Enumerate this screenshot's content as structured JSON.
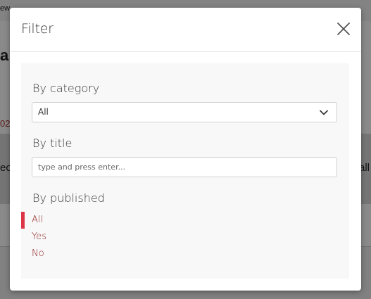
{
  "background": {
    "frag_top": "ew",
    "frag_header": "a",
    "frag_red": "02",
    "frag_left": "ect",
    "frag_right": "all"
  },
  "modal": {
    "title": "Filter",
    "category": {
      "label": "By category",
      "selected": "All"
    },
    "title_filter": {
      "label": "By title",
      "placeholder": "type and press enter..."
    },
    "published": {
      "label": "By published",
      "options": [
        {
          "label": "All",
          "active": true
        },
        {
          "label": "Yes",
          "active": false
        },
        {
          "label": "No",
          "active": false
        }
      ]
    }
  },
  "colors": {
    "accent": "#dc3545",
    "option_text": "#8b1a1a"
  }
}
